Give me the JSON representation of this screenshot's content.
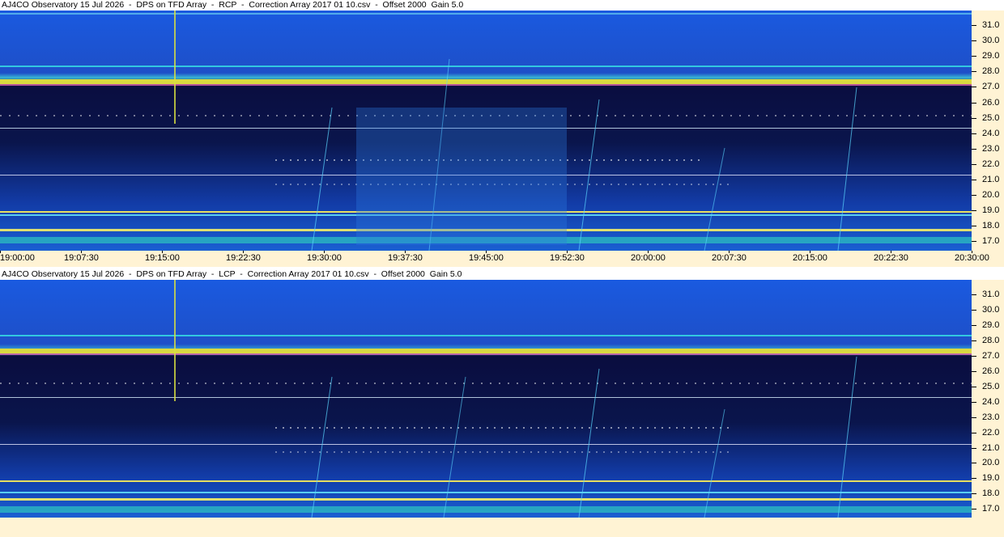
{
  "panels": [
    {
      "id": "rcp",
      "title": "AJ4CO Observatory 15 Jul 2026  -  DPS on TFD Array  -  RCP  -  Correction Array 2017 01 10.csv  -  Offset 2000  Gain 5.0"
    },
    {
      "id": "lcp",
      "title": "AJ4CO Observatory 15 Jul 2026  -  DPS on TFD Array  -  LCP  -  Correction Array 2017 01 10.csv  -  Offset 2000  Gain 5.0"
    }
  ],
  "frequency_axis": {
    "labels": [
      "31.0",
      "30.0",
      "29.0",
      "28.0",
      "27.0",
      "26.0",
      "25.0",
      "24.0",
      "23.0",
      "22.0",
      "21.0",
      "20.0",
      "19.0",
      "18.0",
      "17.0"
    ]
  },
  "time_axis": {
    "labels": [
      "19:00:00",
      "19:07:30",
      "19:15:00",
      "19:22:30",
      "19:30:00",
      "19:37:30",
      "19:45:00",
      "19:52:30",
      "20:00:00",
      "20:07:30",
      "20:15:00",
      "20:22:30",
      "20:30:00"
    ]
  },
  "colors": {
    "axis_background": "#fff3d4",
    "high_band": "#1a50d6",
    "low_band": "#050a3a",
    "interference": "#f2e44a"
  }
}
